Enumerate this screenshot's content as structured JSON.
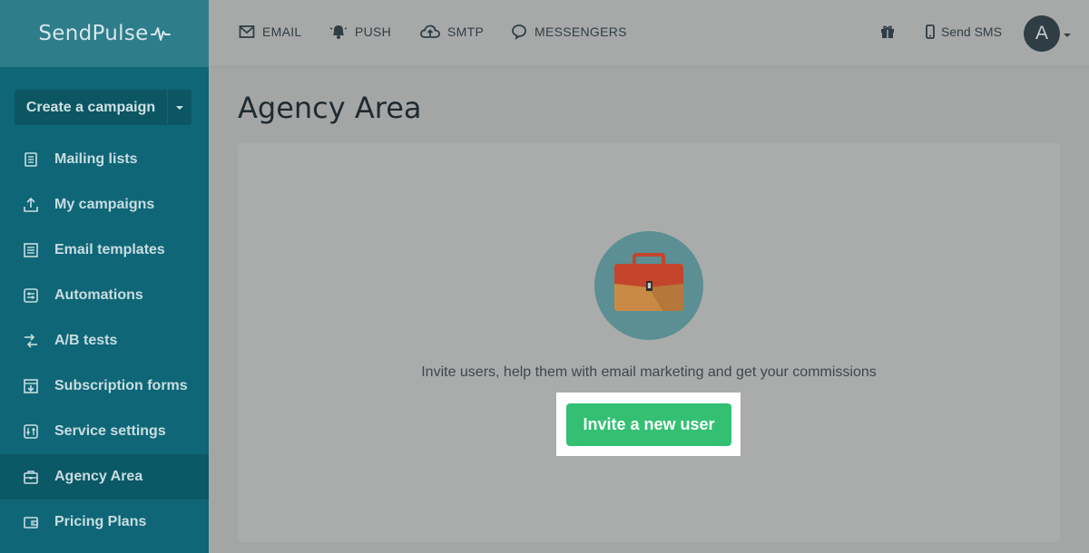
{
  "brand": {
    "name": "SendPulse"
  },
  "sidebar": {
    "create_label": "Create a campaign",
    "items": [
      {
        "label": "Mailing lists",
        "icon": "list-icon"
      },
      {
        "label": "My campaigns",
        "icon": "upload-tray-icon"
      },
      {
        "label": "Email templates",
        "icon": "template-icon"
      },
      {
        "label": "Automations",
        "icon": "automation-icon"
      },
      {
        "label": "A/B tests",
        "icon": "ab-test-icon"
      },
      {
        "label": "Subscription forms",
        "icon": "form-icon"
      },
      {
        "label": "Service settings",
        "icon": "sliders-icon"
      },
      {
        "label": "Agency Area",
        "icon": "briefcase-icon",
        "active": true
      },
      {
        "label": "Pricing Plans",
        "icon": "wallet-icon"
      }
    ]
  },
  "header": {
    "nav": [
      {
        "label": "EMAIL",
        "icon": "envelope-icon"
      },
      {
        "label": "PUSH",
        "icon": "bell-icon"
      },
      {
        "label": "SMTP",
        "icon": "cloud-upload-icon"
      },
      {
        "label": "MESSENGERS",
        "icon": "chat-bubble-icon"
      }
    ],
    "send_sms": "Send SMS",
    "avatar_letter": "A"
  },
  "main": {
    "title": "Agency Area",
    "description": "Invite users, help them with email marketing and get your commissions",
    "invite_label": "Invite a new user"
  },
  "colors": {
    "sidebar": "#0f6677",
    "accent_button": "#33c073",
    "briefcase_circle": "#5b8f93"
  }
}
